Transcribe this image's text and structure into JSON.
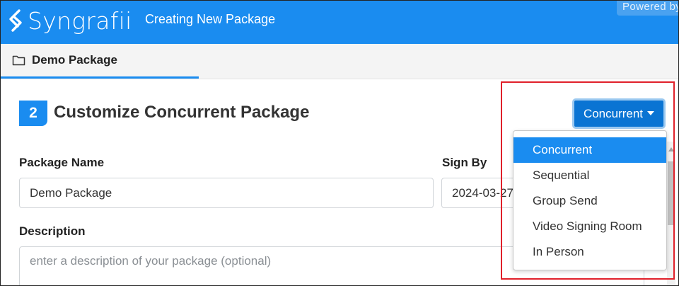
{
  "header": {
    "logo_text": "Syngrafii",
    "subtitle": "Creating New Package",
    "powered_text": "Powered by"
  },
  "tab": {
    "label": "Demo Package",
    "icon": "folder-icon"
  },
  "step": {
    "number": "2",
    "title": "Customize Concurrent Package"
  },
  "form": {
    "package_name_label": "Package Name",
    "package_name_value": "Demo Package",
    "sign_by_label": "Sign By",
    "sign_by_value": "2024-03-27",
    "description_label": "Description",
    "description_placeholder": "enter a description of your package (optional)"
  },
  "dropdown": {
    "selected": "Concurrent",
    "options": [
      "Concurrent",
      "Sequential",
      "Group Send",
      "Video Signing Room",
      "In Person"
    ]
  },
  "colors": {
    "brand": "#1a8cf0",
    "button": "#0a74d3",
    "highlight": "#e0202a"
  }
}
